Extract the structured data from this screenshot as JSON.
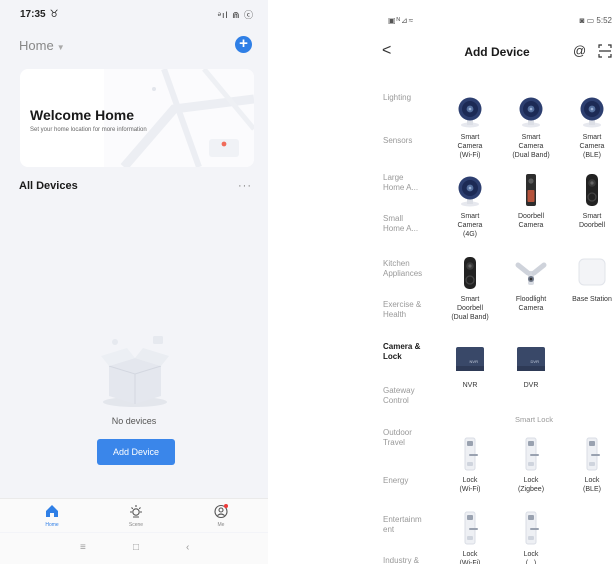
{
  "left": {
    "status": {
      "time": "17:35",
      "alarm": "♉",
      "icons": "ᵊıl ⋒ ⓒ"
    },
    "home_selector": "Home",
    "welcome": {
      "title": "Welcome Home",
      "subtitle": "Set your home location for more information"
    },
    "all_devices": "All Devices",
    "more": "···",
    "no_devices": "No devices",
    "add_device": "Add Device",
    "tabs": [
      {
        "label": "Home",
        "icon": "home-icon",
        "active": true
      },
      {
        "label": "Scene",
        "icon": "sun-icon",
        "active": false
      },
      {
        "label": "Me",
        "icon": "profile-icon",
        "active": false
      }
    ],
    "nav": {
      "menu": "≡",
      "home": "□",
      "back": "‹"
    },
    "colors": {
      "accent": "#2f7fe6",
      "button": "#3a86ea",
      "background": "#f3f4f8"
    }
  },
  "right": {
    "status": {
      "left_icons": "▣ᴺ⊿≈",
      "right": "5:52"
    },
    "title": "Add Device",
    "back": "<",
    "at_icon": "@",
    "categories": [
      {
        "label": "Lighting",
        "active": false
      },
      {
        "label": "Sensors",
        "active": false
      },
      {
        "label": "Large\nHome A...",
        "active": false
      },
      {
        "label": "Small\nHome A...",
        "active": false
      },
      {
        "label": "Kitchen\nAppliances",
        "active": false
      },
      {
        "label": "Exercise &\nHealth",
        "active": false
      },
      {
        "label": "Camera &\nLock",
        "active": true
      },
      {
        "label": "Gateway\nControl",
        "active": false
      },
      {
        "label": "Outdoor\nTravel",
        "active": false
      },
      {
        "label": "Energy",
        "active": false
      },
      {
        "label": "Entertainm\nent",
        "active": false
      },
      {
        "label": "Industry &",
        "active": false
      }
    ],
    "devices": [
      {
        "label": "Smart\nCamera\n(Wi-Fi)",
        "icon": "camera-icon"
      },
      {
        "label": "Smart\nCamera\n(Dual Band)",
        "icon": "camera-icon"
      },
      {
        "label": "Smart\nCamera\n(BLE)",
        "icon": "camera-icon"
      },
      {
        "label": "Smart\nCamera\n(4G)",
        "icon": "camera-icon"
      },
      {
        "label": "Doorbell\nCamera",
        "icon": "doorbell-camera-icon"
      },
      {
        "label": "Smart\nDoorbell",
        "icon": "smart-doorbell-icon"
      },
      {
        "label": "Smart\nDoorbell\n(Dual Band)",
        "icon": "smart-doorbell-icon"
      },
      {
        "label": "Floodlight\nCamera",
        "icon": "floodlight-icon"
      },
      {
        "label": "Base Station",
        "icon": "base-station-icon"
      },
      {
        "label": "NVR",
        "icon": "nvr-icon",
        "badge": "NVR"
      },
      {
        "label": "DVR",
        "icon": "dvr-icon",
        "badge": "DVR"
      },
      {
        "label": "Lock\n(Wi-Fi)",
        "icon": "lock-icon"
      },
      {
        "label": "Lock\n(Zigbee)",
        "icon": "lock-icon"
      },
      {
        "label": "Lock\n(BLE)",
        "icon": "lock-icon"
      },
      {
        "label": "Lock\n(Wi-Fi)",
        "icon": "lock-icon"
      },
      {
        "label": "Lock\n(...)",
        "icon": "lock-icon"
      }
    ],
    "smart_lock_header": "Smart Lock"
  }
}
